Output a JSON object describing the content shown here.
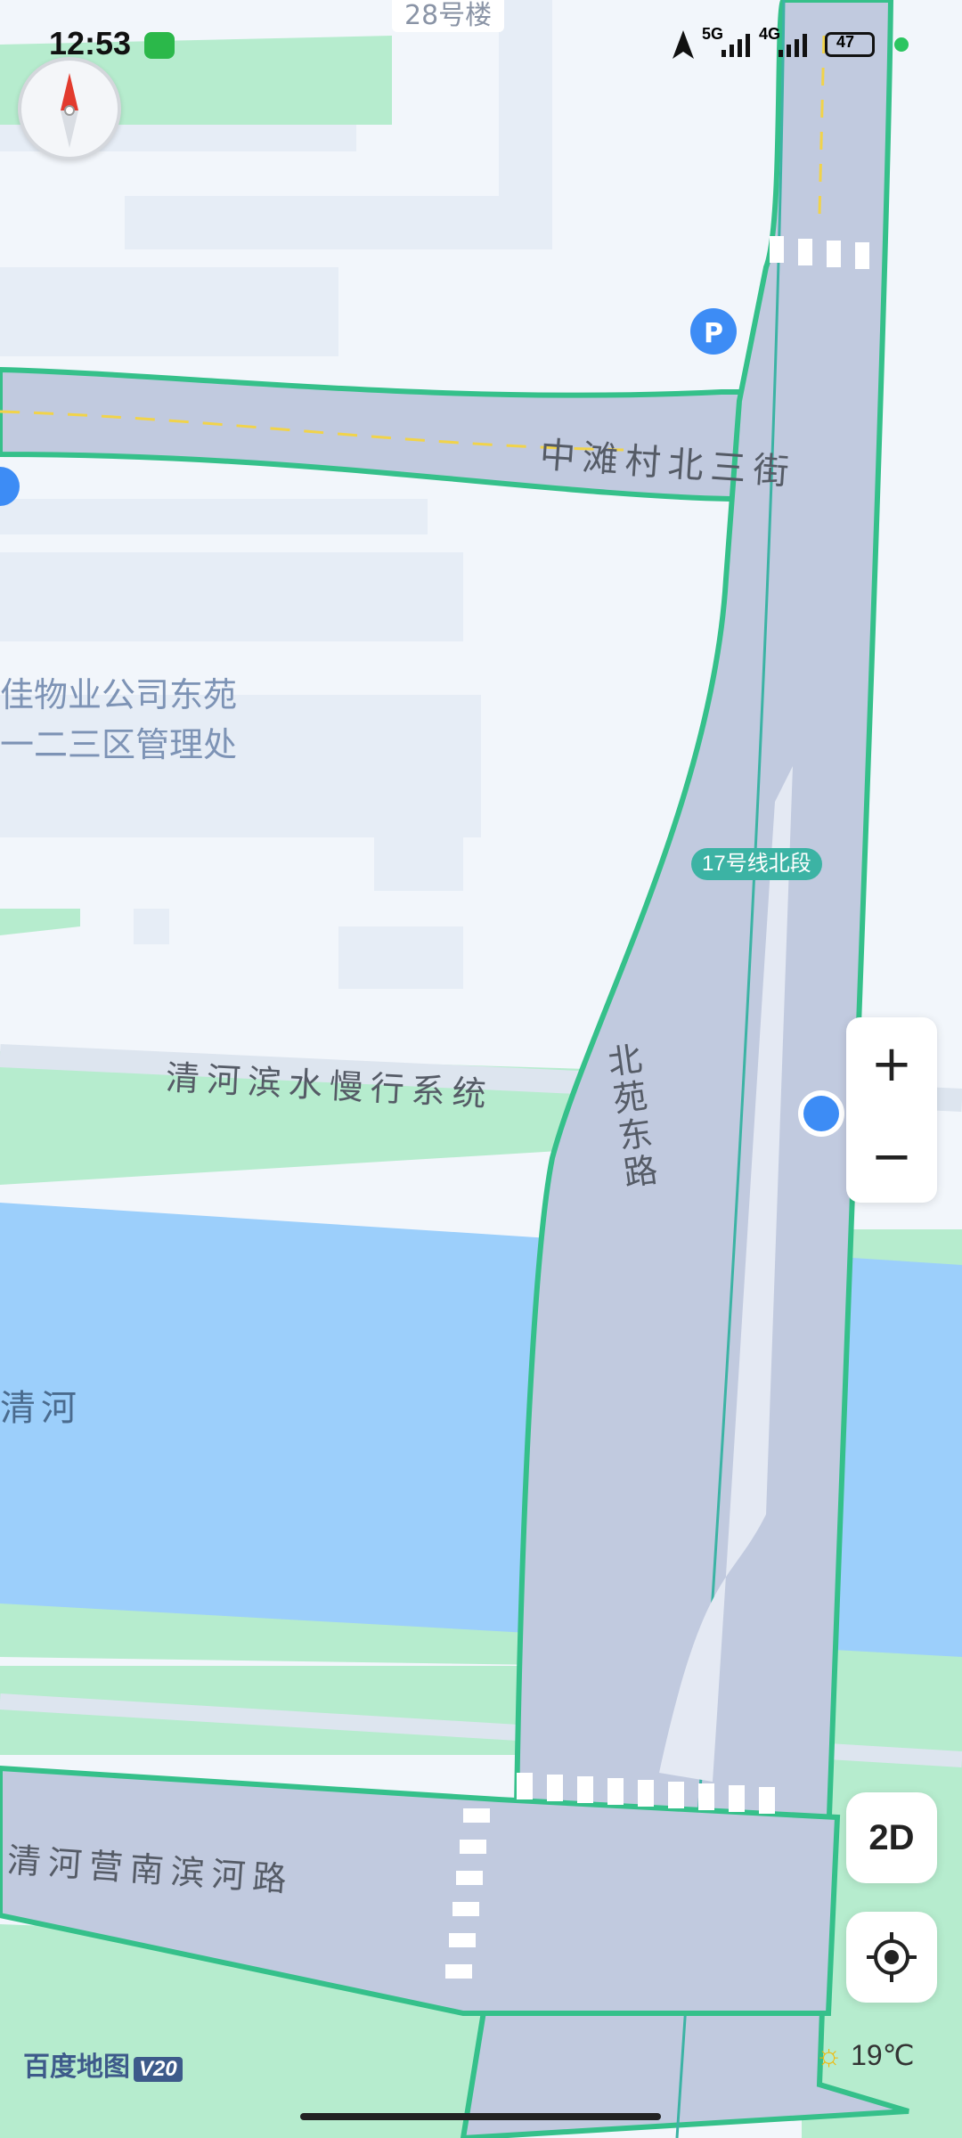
{
  "status_bar": {
    "time": "12:53",
    "network_1": "5G",
    "network_2": "4G",
    "battery": "47",
    "icons": [
      "wechat-icon",
      "navigation-arrow-icon",
      "signal-icon",
      "battery-icon"
    ]
  },
  "map": {
    "top_building_label": "28号楼",
    "roads": {
      "north_street": "中滩村北三街",
      "beiyuan_road": "北苑东路",
      "slow_path": "清河滨水慢行系统",
      "south_road": "清河营南滨河路"
    },
    "poi_line_1": "佳物业公司东苑",
    "poi_line_2": "一二三区管理处",
    "river": "清河",
    "metro_badge": "17号线北段",
    "colors": {
      "road": "#c1cadf",
      "road_border": "#35c08a",
      "water": "#9ccffb",
      "green": "#b6ecce",
      "block": "#e8eef6",
      "location_dot": "#3d8cf5"
    }
  },
  "controls": {
    "zoom_in": "+",
    "zoom_out": "−",
    "mode": "2D"
  },
  "footer": {
    "logo": "百度地图",
    "version": "V20",
    "temperature": "19℃"
  }
}
